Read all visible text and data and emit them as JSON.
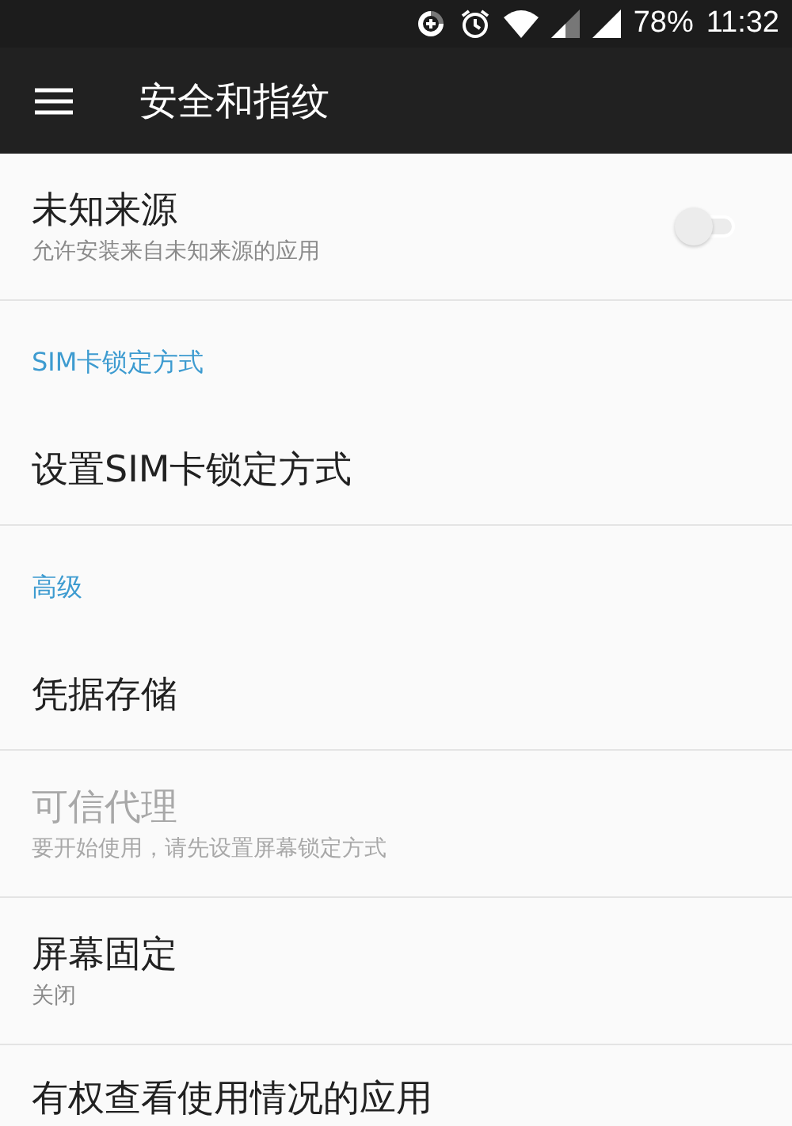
{
  "status_bar": {
    "battery": "78%",
    "time": "11:32"
  },
  "toolbar": {
    "title": "安全和指纹"
  },
  "items": [
    {
      "kind": "setting",
      "title": "未知来源",
      "summary": "允许安装来自未知来源的应用",
      "disabled": false,
      "toggle": {
        "on": false
      }
    },
    {
      "kind": "header",
      "title": "SIM卡锁定方式"
    },
    {
      "kind": "setting",
      "title": "设置SIM卡锁定方式",
      "disabled": false
    },
    {
      "kind": "header",
      "title": "高级"
    },
    {
      "kind": "setting",
      "title": "凭据存储",
      "disabled": false
    },
    {
      "kind": "setting",
      "title": "可信代理",
      "summary": "要开始使用，请先设置屏幕锁定方式",
      "disabled": true
    },
    {
      "kind": "setting",
      "title": "屏幕固定",
      "summary": "关闭",
      "disabled": false
    },
    {
      "kind": "setting",
      "title": "有权查看使用情况的应用",
      "disabled": false
    }
  ]
}
